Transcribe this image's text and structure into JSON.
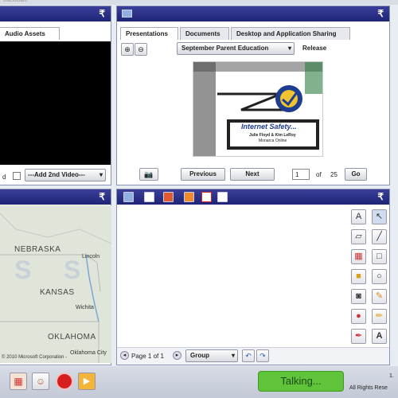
{
  "audio_panel": {
    "tab": "Audio Assets",
    "add_video_label": "---Add 2nd Video---",
    "partial_label": "d"
  },
  "presentation_panel": {
    "tabs": [
      "Presentations",
      "Documents",
      "Desktop and Application Sharing"
    ],
    "dropdown_value": "September Parent Education",
    "release_label": "Release",
    "slide": {
      "title": "Internet Safety...",
      "authors": "Julie Floyd & Kim LeRoy",
      "org": "Monarca Online"
    },
    "prev_label": "Previous",
    "next_label": "Next",
    "page_current": "1",
    "page_of": "of",
    "page_total": "25",
    "go_label": "Go"
  },
  "map_panel": {
    "states": [
      "NEBRASKA",
      "KANSAS",
      "OKLAHOMA"
    ],
    "cities": [
      "Lincoln",
      "Wichita",
      "Oklahoma City"
    ],
    "copyright": "© 2010 Microsoft Corporation -"
  },
  "whiteboard_panel": {
    "page_label": "Page 1 of 1",
    "group_label": "Group"
  },
  "bottom_bar": {
    "talking_label": "Talking...",
    "version": "1.",
    "rights": "All Rights Rese"
  },
  "colors": {
    "header": "#232a80",
    "talking_green": "#5fc43a"
  }
}
